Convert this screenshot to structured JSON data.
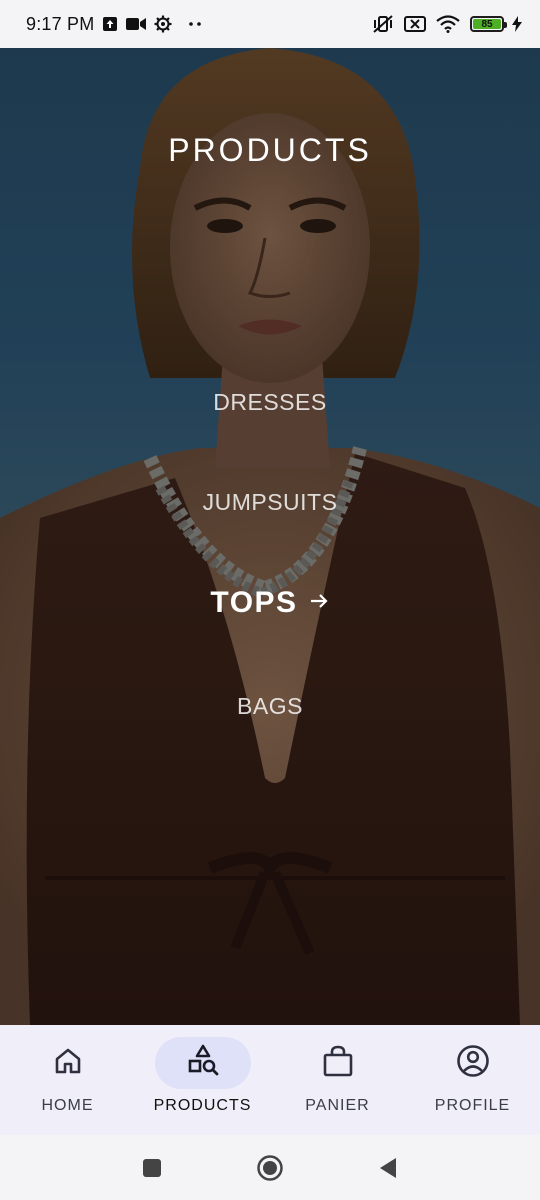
{
  "status_bar": {
    "time": "9:17 PM",
    "left_icons": [
      "upload-box-icon",
      "video-camera-icon",
      "settings-gear-icon",
      "more-dots-icon"
    ],
    "right_icons": [
      "vibrate-mute-icon",
      "sim-off-icon",
      "wifi-icon",
      "battery-icon",
      "charging-bolt-icon"
    ],
    "battery_level": "85",
    "battery_color": "#4caf24"
  },
  "hero": {
    "title": "PRODUCTS",
    "background": "fashion-model-photo",
    "categories": [
      {
        "label": "DRESSES",
        "selected": false
      },
      {
        "label": "JUMPSUITS",
        "selected": false
      },
      {
        "label": "TOPS",
        "selected": true,
        "arrow": "→"
      },
      {
        "label": "BAGS",
        "selected": false
      }
    ]
  },
  "bottom_nav": {
    "items": [
      {
        "label": "HOME",
        "icon": "home-icon",
        "active": false
      },
      {
        "label": "PRODUCTS",
        "icon": "shapes-search-icon",
        "active": true
      },
      {
        "label": "PANIER",
        "icon": "shopping-bag-icon",
        "active": false
      },
      {
        "label": "PROFILE",
        "icon": "profile-circle-icon",
        "active": false
      }
    ],
    "active_pill_color": "#dfe1f8",
    "background_color": "#f0eef8"
  },
  "system_nav": {
    "buttons": [
      "recents-square-icon",
      "home-circle-icon",
      "back-triangle-icon"
    ]
  }
}
